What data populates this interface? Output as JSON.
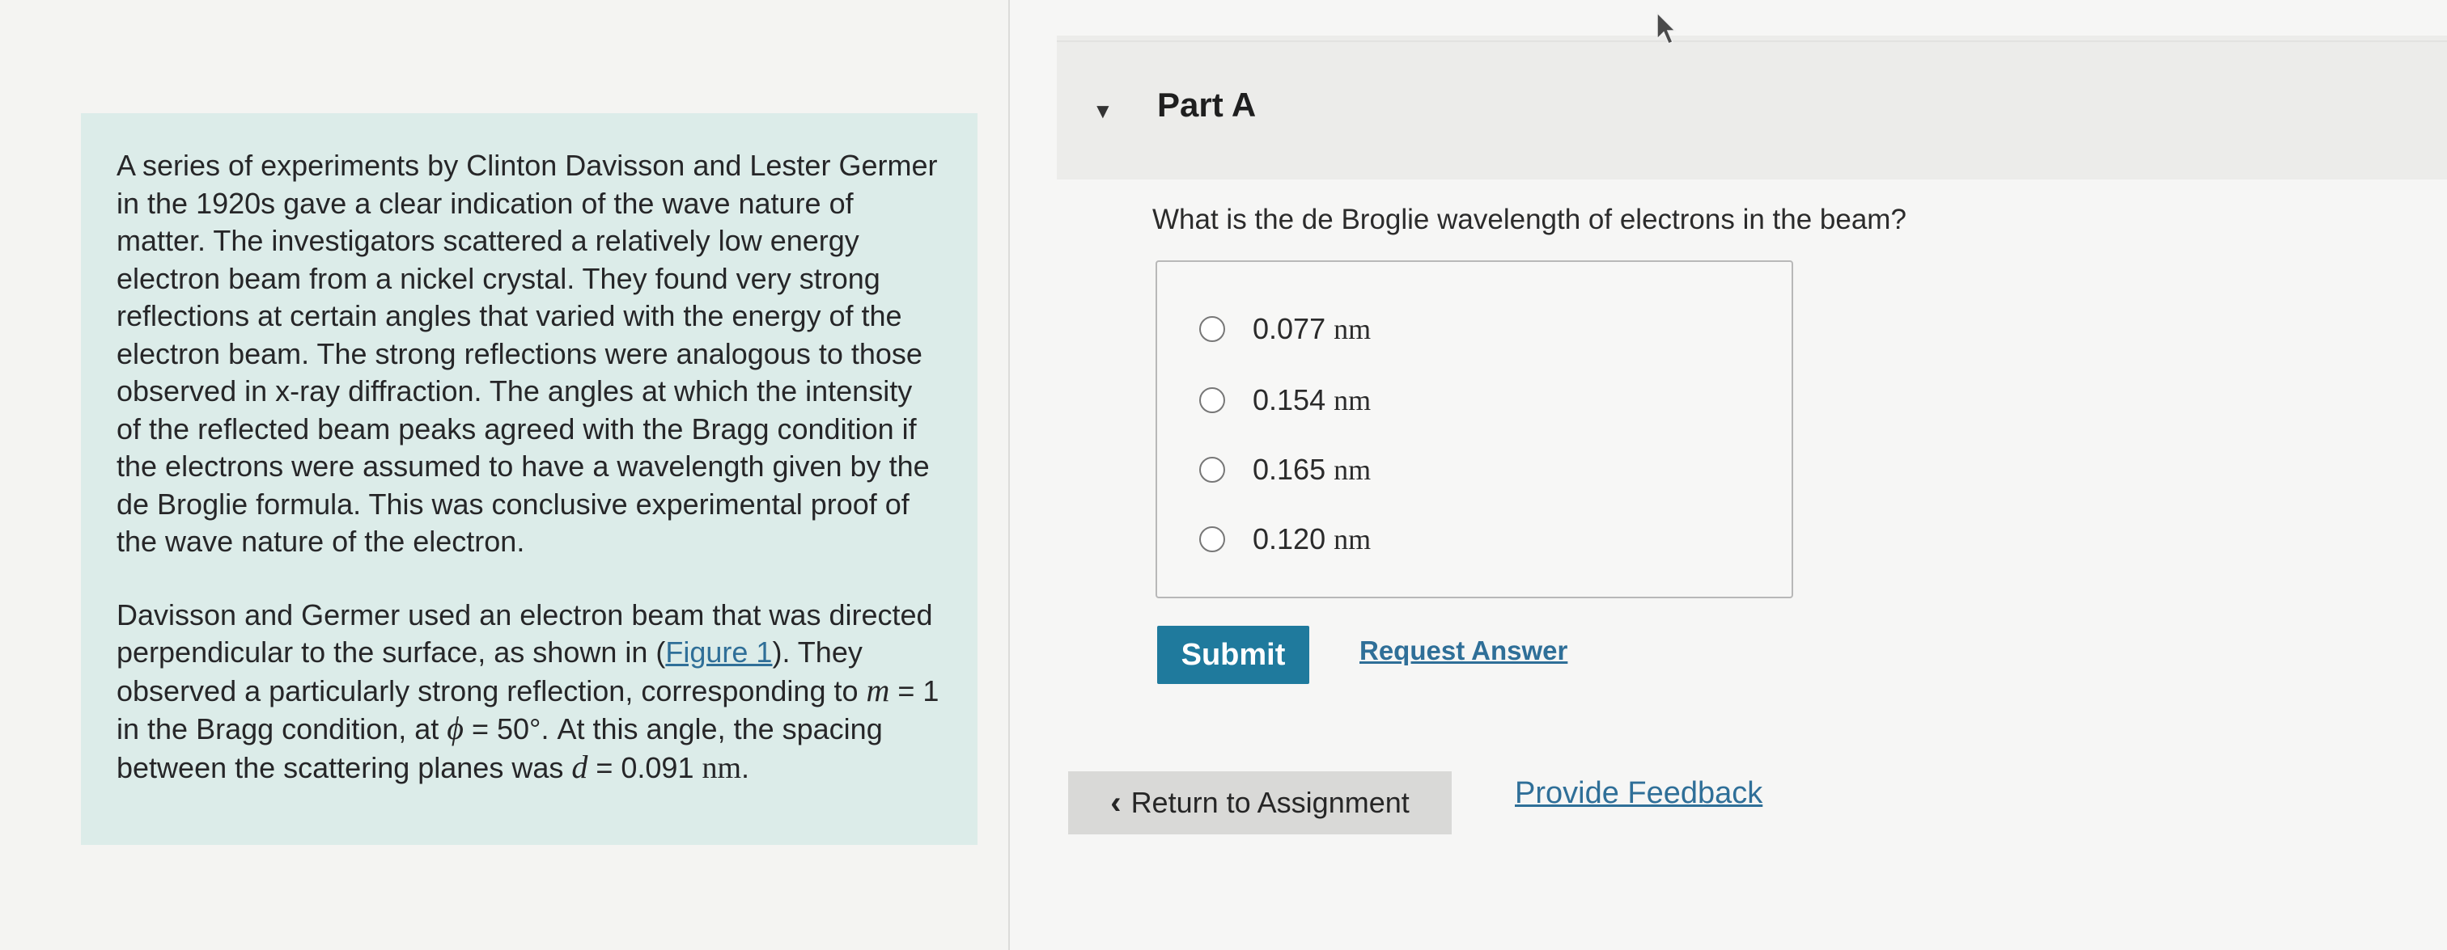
{
  "context": {
    "paragraph1": "A series of experiments by Clinton Davisson and Lester Germer in the 1920s gave a clear indication of the wave nature of matter. The investigators scattered a relatively low energy electron beam from a nickel crystal. They found very strong reflections at certain angles that varied with the energy of the electron beam. The strong reflections were analogous to those observed in x-ray diffraction. The angles at which the intensity of the reflected beam peaks agreed with the Bragg condition if the electrons were assumed to have a wavelength given by the de Broglie formula. This was conclusive experimental proof of the wave nature of the electron.",
    "p2_text1": "Davisson and Germer used an electron beam that was directed perpendicular to the surface, as shown in ",
    "p2_paren_open": "(",
    "figure_link": "Figure 1",
    "p2_text2": "). They observed a particularly strong reflection, corresponding to ",
    "m_var": "m",
    "m_value": " = 1",
    "p2_text3": " in the Bragg condition, at ",
    "phi_var": "ϕ",
    "phi_value": " = 50°",
    "p2_text4": ". At this angle, the spacing between the scattering planes was ",
    "d_var": "d",
    "d_value": " = 0.091 ",
    "d_unit": "nm",
    "p2_end": "."
  },
  "part": {
    "title": "Part A",
    "question": "What is the de Broglie wavelength of electrons in the beam?"
  },
  "choices": [
    {
      "value": "0.077",
      "unit": "nm"
    },
    {
      "value": "0.154",
      "unit": "nm"
    },
    {
      "value": "0.165",
      "unit": "nm"
    },
    {
      "value": "0.120",
      "unit": "nm"
    }
  ],
  "actions": {
    "submit_label": "Submit",
    "request_answer_label": "Request Answer",
    "return_label": "Return to Assignment",
    "feedback_label": "Provide Feedback"
  }
}
